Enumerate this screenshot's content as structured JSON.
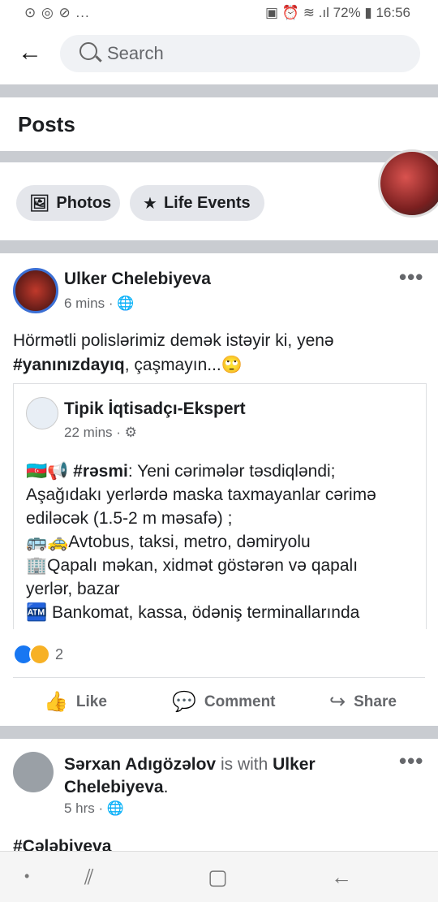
{
  "status_bar": {
    "left_icons": "⊙ ◎ ⊘ ...",
    "battery": "72%",
    "time": "16:56"
  },
  "search": {
    "placeholder": "Search"
  },
  "section": {
    "title": "Posts"
  },
  "filters": [
    {
      "label": "Photos",
      "icon": "photos-icon"
    },
    {
      "label": "Life Events",
      "icon": "flag-icon"
    }
  ],
  "post1": {
    "author": "Ulker Chelebiyeva",
    "time": "6 mins",
    "text_line1": "Hörmətli polislərimiz demək istəyir ki, yenə",
    "text_hashtag": "#yanınızdayıq",
    "text_rest": ", çaşmayın...🙄",
    "shared": {
      "author": "Tipik İqtisadçı-Ekspert",
      "time": "22 mins",
      "line1_hashtag": "#rəsmi",
      "line1_rest": ": Yeni cərimələr təsdiqləndi;",
      "line2": "Aşağıdakı yerlərdə maska taxmayanlar cərimə",
      "line3": "ediləcək (1.5-2 m məsafə) ;",
      "line4": "Avtobus, taksi, metro, dəmiryolu",
      "line5": "Qapalı məkan, xidmət göstərən və qapalı",
      "line6": "yerlər, bazar",
      "line7": "Bankomat, kassa, ödəniş terminallarında"
    },
    "reaction_count": "2",
    "actions": {
      "like": "Like",
      "comment": "Comment",
      "share": "Share"
    }
  },
  "post2": {
    "author": "Sərxan Adıgözəlov",
    "with_text": " is with ",
    "tagged": "Ulker",
    "tagged2": "Chelebiyeva",
    "time": "5 hrs",
    "text": "#Çələbiyeva"
  }
}
